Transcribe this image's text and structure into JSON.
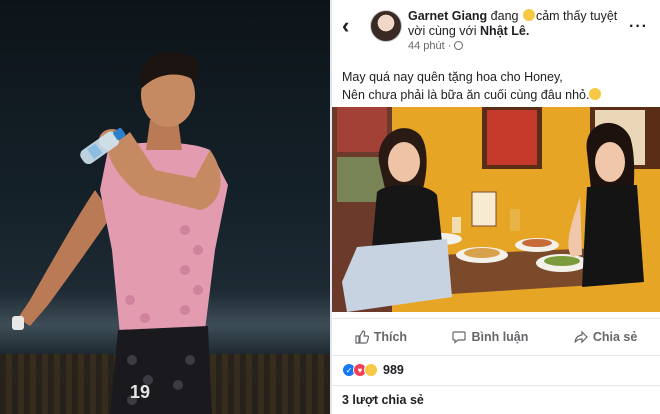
{
  "post": {
    "author": "Garnet Giang",
    "feeling_prefix": "đang",
    "feeling_text": "cảm thấy tuyệt",
    "with_text": "vời cùng với",
    "tagged": "Nhật Lê.",
    "time": "44 phút ·",
    "caption_line1": "May quá nay quên tặng hoa cho Honey,",
    "caption_line2": "Nên chưa phải là bữa ăn cuối cùng đâu nhỏ.",
    "actions": {
      "like": "Thích",
      "comment": "Bình luận",
      "share": "Chia sẻ"
    },
    "reaction_count": "989",
    "share_count": "3 lượt chia sẻ",
    "more": "···",
    "back": "‹"
  },
  "icons": {
    "back": "chevron-left-icon",
    "more": "more-horizontal-icon",
    "privacy": "globe-icon",
    "like": "thumbs-up-icon",
    "comment": "comment-bubble-icon",
    "share": "share-arrow-icon"
  },
  "colors": {
    "brand_blue": "#1877f2",
    "love_red": "#f33e58",
    "haha_yellow": "#f7c843",
    "jersey_pink": "#e39bb0"
  }
}
